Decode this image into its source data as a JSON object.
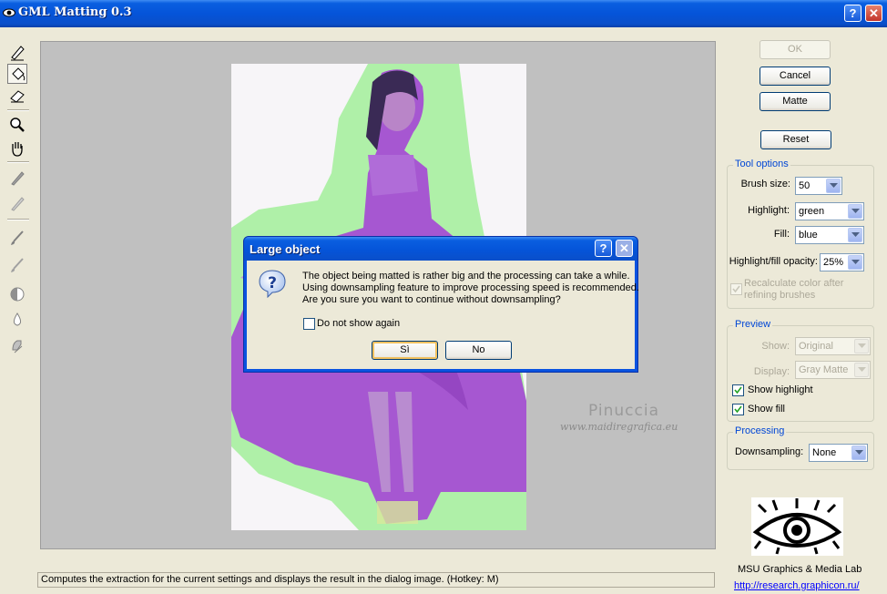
{
  "window": {
    "title": "GML Matting 0.3",
    "help_label": "?",
    "close_label": "✕"
  },
  "toolbar": {
    "tools": [
      "highlighter-tool-icon",
      "fill-bucket-tool-icon",
      "eraser-tool-icon",
      "zoom-tool-icon",
      "hand-tool-icon",
      "pencil-tool-icon",
      "pencil-light-tool-icon",
      "brush-tool-icon",
      "brush-light-tool-icon",
      "contrast-tool-icon",
      "drop-tool-icon",
      "smudge-tool-icon"
    ],
    "selected": "fill-bucket-tool-icon"
  },
  "canvas": {
    "watermark_title": "Pinuccia",
    "watermark_url": "www.maidiregrafica.eu"
  },
  "actions": {
    "ok": "OK",
    "cancel": "Cancel",
    "matte": "Matte",
    "reset": "Reset"
  },
  "tool_options": {
    "title": "Tool options",
    "brush_size_label": "Brush size:",
    "brush_size_value": "50",
    "highlight_label": "Highlight:",
    "highlight_value": "green",
    "fill_label": "Fill:",
    "fill_value": "blue",
    "opacity_label": "Highlight/fill opacity:",
    "opacity_value": "25%",
    "recalc_line1": "Recalculate color after",
    "recalc_line2": "refining brushes",
    "recalc_checked": true
  },
  "preview": {
    "title": "Preview",
    "show_label": "Show:",
    "show_value": "Original",
    "display_label": "Display:",
    "display_value": "Gray Matte",
    "show_highlight_label": "Show highlight",
    "show_highlight_checked": true,
    "show_fill_label": "Show fill",
    "show_fill_checked": true
  },
  "processing": {
    "title": "Processing",
    "downsampling_label": "Downsampling:",
    "downsampling_value": "None"
  },
  "logo": {
    "name": "MSU Graphics & Media Lab",
    "url": "http://research.graphicon.ru/"
  },
  "status": {
    "text": "Computes the extraction for the current settings and displays the result in the dialog image. (Hotkey: M)"
  },
  "dialog": {
    "title": "Large object",
    "message_lines": [
      "The object being matted is rather big and the processing can take a while.",
      "Using downsampling feature to improve processing speed is recommended.",
      "Are you sure you want to continue without downsampling?"
    ],
    "do_not_show_label": "Do not show again",
    "do_not_show_checked": false,
    "yes_label": "Sì",
    "no_label": "No",
    "icon": "question-icon"
  },
  "colors": {
    "titlebar": "#0554d9",
    "highlight": "#a6f0a0",
    "fill": "#a040d0",
    "background": "#ece9d8",
    "canvas": "#c0c0c0",
    "group_title": "#0046d5"
  }
}
